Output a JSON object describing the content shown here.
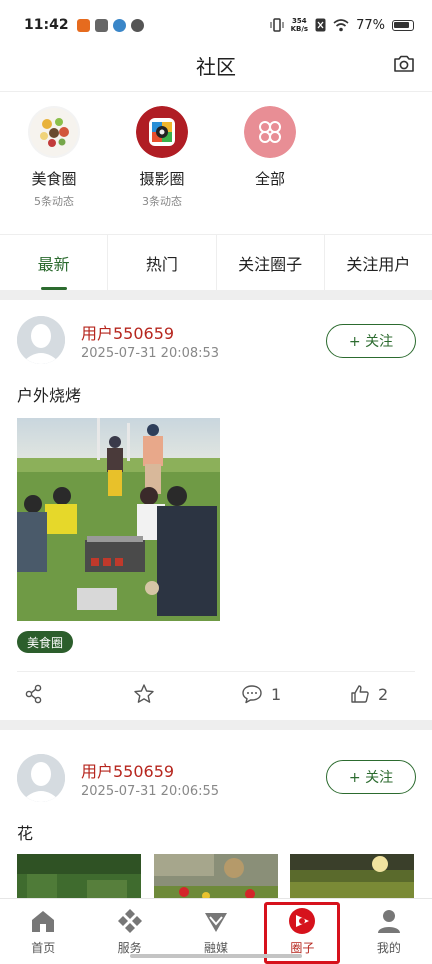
{
  "status_bar": {
    "time": "11:42",
    "net_speed_value": "354",
    "net_speed_unit": "KB/s",
    "battery": "77%"
  },
  "header": {
    "title": "社区"
  },
  "circles": [
    {
      "name": "美食圈",
      "sub": "5条动态"
    },
    {
      "name": "摄影圈",
      "sub": "3条动态"
    },
    {
      "name": "全部",
      "sub": ""
    }
  ],
  "tabs": [
    "最新",
    "热门",
    "关注圈子",
    "关注用户"
  ],
  "posts": [
    {
      "user": "用户550659",
      "time": "2025-07-31 20:08:53",
      "follow_label": "+ 关注",
      "text": "户外烧烤",
      "tag": "美食圈",
      "comments": "1",
      "likes": "2"
    },
    {
      "user": "用户550659",
      "time": "2025-07-31 20:06:55",
      "follow_label": "+ 关注",
      "text": "花"
    }
  ],
  "bottom_nav": [
    {
      "label": "首页",
      "icon": "home-icon"
    },
    {
      "label": "服务",
      "icon": "diamond-grid-icon"
    },
    {
      "label": "融媒",
      "icon": "gem-icon"
    },
    {
      "label": "圈子",
      "icon": "circle-logo-icon"
    },
    {
      "label": "我的",
      "icon": "user-icon"
    }
  ],
  "colors": {
    "accent_green": "#2c6b2f",
    "username_red": "#b6261e",
    "highlight_red": "#d6121c"
  }
}
